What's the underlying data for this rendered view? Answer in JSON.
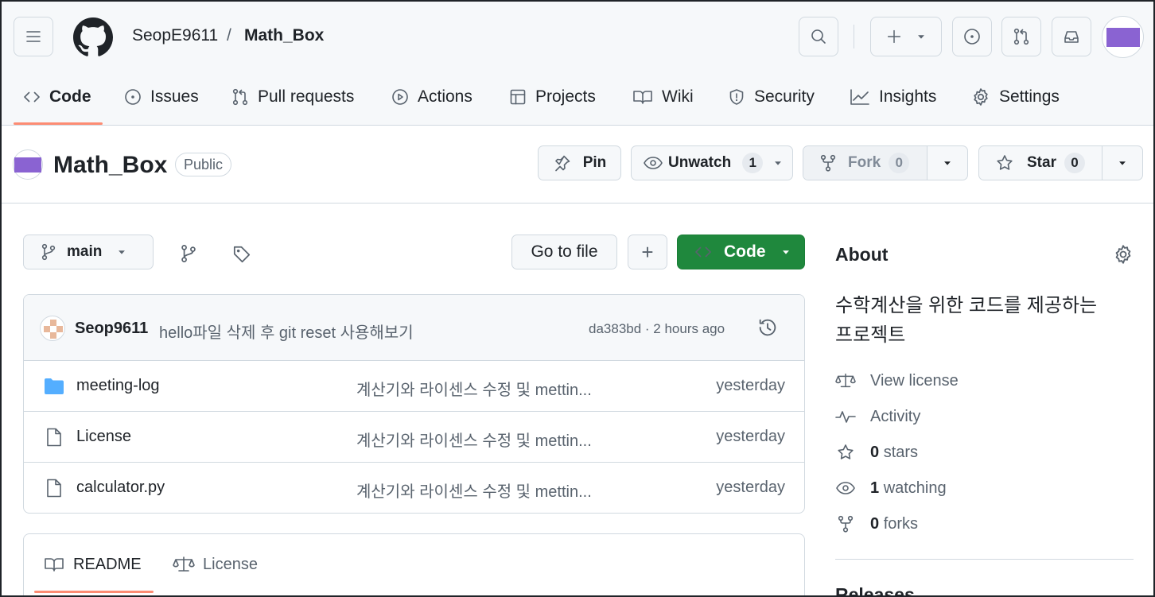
{
  "header": {
    "owner": "SeopE9611",
    "separator": "/",
    "repo": "Math_Box"
  },
  "tabs": [
    {
      "label": "Code",
      "icon": "code-icon",
      "active": true
    },
    {
      "label": "Issues",
      "icon": "issue-icon"
    },
    {
      "label": "Pull requests",
      "icon": "pull-request-icon"
    },
    {
      "label": "Actions",
      "icon": "play-icon"
    },
    {
      "label": "Projects",
      "icon": "table-icon"
    },
    {
      "label": "Wiki",
      "icon": "book-icon"
    },
    {
      "label": "Security",
      "icon": "shield-icon"
    },
    {
      "label": "Insights",
      "icon": "graph-icon"
    },
    {
      "label": "Settings",
      "icon": "gear-icon"
    }
  ],
  "repo": {
    "name": "Math_Box",
    "visibility": "Public",
    "pin_label": "Pin",
    "unwatch_label": "Unwatch",
    "watch_count": "1",
    "fork_label": "Fork",
    "fork_count": "0",
    "star_label": "Star",
    "star_count": "0"
  },
  "toolbar": {
    "branch": "main",
    "go_to_file": "Go to file",
    "add": "+",
    "code_button": "Code"
  },
  "commit": {
    "author": "Seop9611",
    "message": "hello파일 삭제 후 git reset 사용해보기",
    "meta": "da383bd · 2 hours ago"
  },
  "files": [
    {
      "name": "meeting-log",
      "type": "folder",
      "message": "계산기와 라이센스 수정 및 mettin...",
      "date": "yesterday"
    },
    {
      "name": "License",
      "type": "file",
      "message": "계산기와 라이센스 수정 및 mettin...",
      "date": "yesterday"
    },
    {
      "name": "calculator.py",
      "type": "file",
      "message": "계산기와 라이센스 수정 및 mettin...",
      "date": "yesterday"
    }
  ],
  "readme_tabs": [
    {
      "label": "README",
      "icon": "book-icon",
      "active": true
    },
    {
      "label": "License",
      "icon": "law-icon"
    }
  ],
  "about": {
    "title": "About",
    "description_line1": "수학계산을 위한 코드를 제공하는",
    "description_line2": "프로젝트",
    "view_license": "View license",
    "activity": "Activity",
    "stars_count": "0",
    "stars_label": "stars",
    "watching_count": "1",
    "watching_label": "watching",
    "forks_count": "0",
    "forks_label": "forks",
    "releases": "Releases"
  },
  "colors": {
    "accent_underline": "#fd8c73",
    "code_button": "#1f883d",
    "avatar": "#8a63d2",
    "folder": "#54aeff"
  }
}
